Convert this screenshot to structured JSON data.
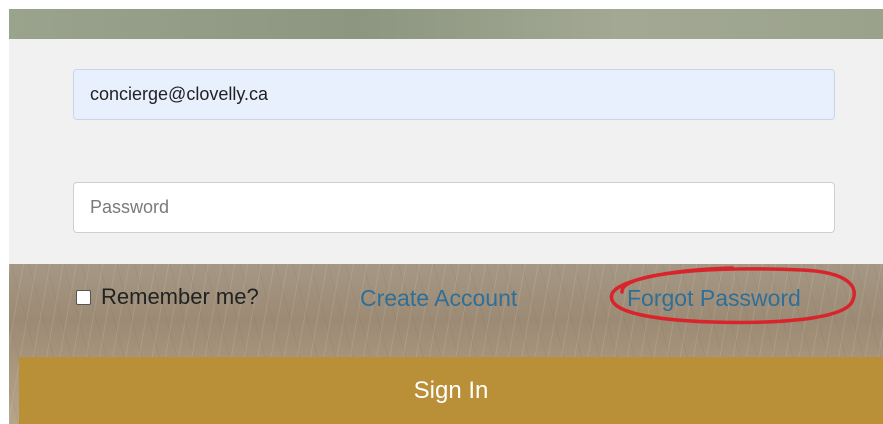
{
  "login_form": {
    "email_value": "concierge@clovelly.ca",
    "password_placeholder": "Password",
    "remember_label": "Remember me?",
    "remember_checked": false,
    "create_account_label": "Create Account",
    "forgot_password_label": "Forgot Password",
    "sign_in_label": "Sign In"
  },
  "colors": {
    "link": "#2f6f97",
    "sign_in_button": "#b98f37",
    "highlight_annotation": "#d9242b",
    "autofill_background": "#e8f0fe"
  }
}
